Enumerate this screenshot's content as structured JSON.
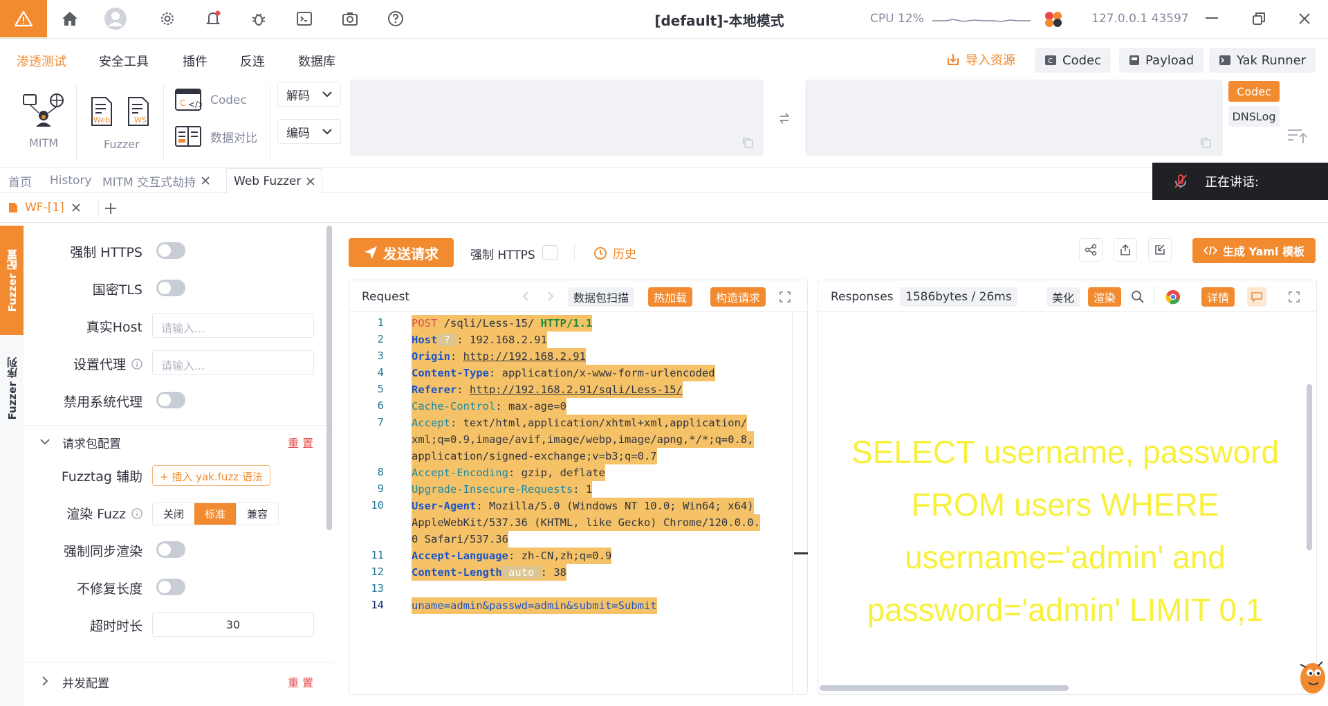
{
  "topbar": {
    "title": "[default]-本地模式",
    "cpu": "CPU 12%",
    "ip": "127.0.0.1 43597"
  },
  "menu": {
    "items": [
      "渗透测试",
      "安全工具",
      "插件",
      "反连",
      "数据库"
    ],
    "import": "导入资源",
    "codec": "Codec",
    "payload": "Payload",
    "yakrunner": "Yak Runner"
  },
  "toolbar": {
    "mitm": "MITM",
    "web": "Web",
    "ws": "WS",
    "fuzzer": "Fuzzer",
    "codec": "Codec",
    "compare": "数据对比",
    "decode": "解码",
    "encode": "编码",
    "codec_tag": "Codec",
    "dnslog": "DNSLog"
  },
  "tabs": {
    "home": "首页",
    "history": "History",
    "mitm": "MITM 交互式劫持",
    "webfuzzer": "Web Fuzzer",
    "wf": "WF-[1]",
    "speaking": "正在讲话:"
  },
  "side": {
    "strip_config": "Fuzzer 配置",
    "strip_seq": "Fuzzer 序列",
    "force_https": "强制 HTTPS",
    "gm_tls": "国密TLS",
    "real_host": "真实Host",
    "real_host_ph": "请输入...",
    "proxy": "设置代理",
    "proxy_ph": "请输入...",
    "disable_sys_proxy": "禁用系统代理",
    "req_config": "请求包配置",
    "reset": "重 置",
    "fuzztag": "Fuzztag 辅助",
    "fuzztag_btn": "+ 插入 yak.fuzz 语法",
    "render_fuzz": "渲染 Fuzz",
    "render_opts": [
      "关闭",
      "标准",
      "兼容"
    ],
    "sync_render": "强制同步渲染",
    "no_fix_len": "不修复长度",
    "timeout": "超时时长",
    "timeout_val": "30",
    "concurrency": "并发配置",
    "reset2": "重 置"
  },
  "main": {
    "send": "发送请求",
    "force_https": "强制 HTTPS",
    "history": "历史",
    "gen_yaml": "生成 Yaml 模板",
    "request": "Request",
    "scan": "数据包扫描",
    "hotload": "热加载",
    "build": "构造请求",
    "responses": "Responses",
    "size": "1586bytes / 26ms",
    "beautify": "美化",
    "render": "渲染",
    "detail": "详情"
  },
  "request_lines": [
    "1",
    "2",
    "3",
    "4",
    "5",
    "6",
    "7",
    "",
    "",
    "8",
    "9",
    "10",
    "",
    "",
    "11",
    "12",
    "13",
    "14"
  ],
  "response_text": [
    "SELECT username, password",
    "FROM users WHERE",
    "username='admin' and",
    "password='admin' LIMIT 0,1"
  ]
}
